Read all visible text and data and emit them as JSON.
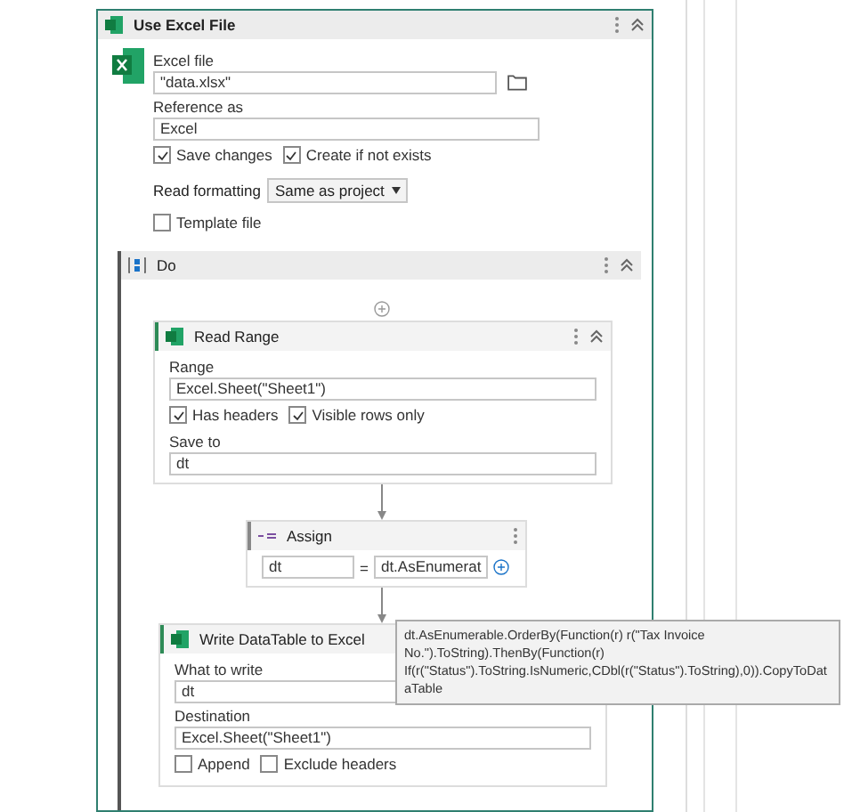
{
  "activity": {
    "title": "Use Excel File",
    "rows": [
      {
        "kind": "field",
        "label": "Excel file",
        "value": "\"data.xlsx\"",
        "browse": true
      },
      {
        "kind": "field",
        "label": "Reference as",
        "value": "Excel"
      },
      {
        "kind": "checks",
        "items": [
          {
            "label": "Save changes",
            "checked": true
          },
          {
            "label": "Create if not exists",
            "checked": true
          }
        ]
      },
      {
        "kind": "dropdown",
        "label": "Read formatting",
        "value": "Same as project"
      },
      {
        "kind": "checks",
        "items": [
          {
            "label": "Template file",
            "checked": false
          }
        ]
      }
    ],
    "do": {
      "title": "Do",
      "activities": [
        {
          "kind": "form",
          "title": "Read Range",
          "rows": [
            {
              "kind": "field",
              "label": "Range",
              "value": "Excel.Sheet(\"Sheet1\")"
            },
            {
              "kind": "checks",
              "items": [
                {
                  "label": "Has headers",
                  "checked": true
                },
                {
                  "label": "Visible rows only",
                  "checked": true
                }
              ]
            },
            {
              "kind": "field",
              "label": "Save to",
              "value": "dt"
            }
          ]
        },
        {
          "kind": "assign",
          "title": "Assign",
          "to": "dt",
          "operator": "=",
          "value": "dt.AsEnumerat",
          "tooltip": "dt.AsEnumerable.OrderBy(Function(r) r(\"Tax Invoice No.\").ToString).ThenBy(Function(r) If(r(\"Status\").ToString.IsNumeric,CDbl(r(\"Status\").ToString),0)).CopyToDataTable"
        },
        {
          "kind": "form",
          "title": "Write DataTable to Excel",
          "rows": [
            {
              "kind": "field",
              "label": "What to write",
              "value": "dt"
            },
            {
              "kind": "field",
              "label": "Destination",
              "value": "Excel.Sheet(\"Sheet1\")"
            },
            {
              "kind": "checks",
              "items": [
                {
                  "label": "Append",
                  "checked": false
                },
                {
                  "label": "Exclude headers",
                  "checked": false
                }
              ]
            }
          ]
        }
      ]
    }
  }
}
